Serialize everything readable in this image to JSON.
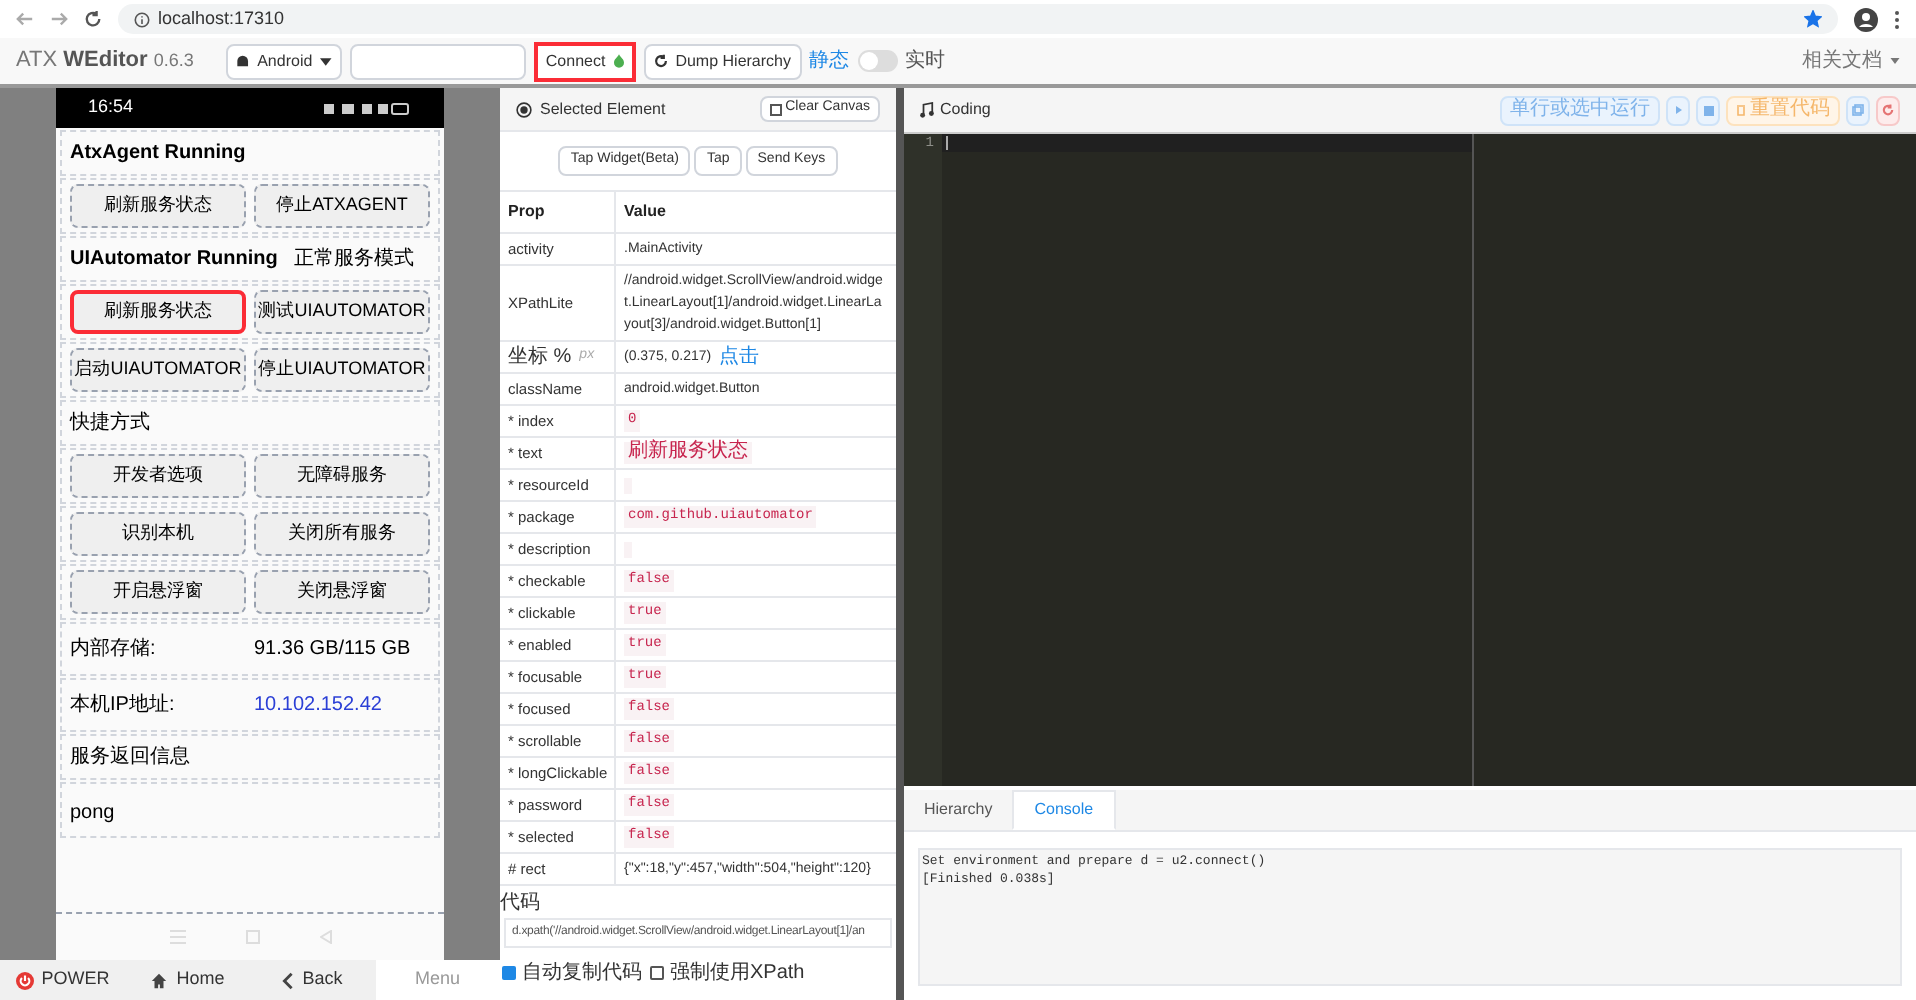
{
  "browser": {
    "url": "localhost:17310",
    "bookmarked": true
  },
  "header": {
    "brand": "ATX",
    "product": "WEditor",
    "version": "0.6.3",
    "platform": "Android",
    "connect": "Connect",
    "dump": "Dump Hierarchy",
    "static_label": "静态",
    "live": false,
    "live_label": "实时",
    "docs": "相关文档"
  },
  "phone": {
    "time": "16:54",
    "rows": [
      {
        "kind": "heading",
        "texts": [
          "AtxAgent Running"
        ],
        "bold": true
      },
      {
        "kind": "buttons",
        "buttons": [
          {
            "label": "刷新服务状态",
            "selected": false
          },
          {
            "label": "停止ATXAGENT",
            "selected": false
          }
        ]
      },
      {
        "kind": "heading",
        "texts": [
          "UIAutomator Running",
          "正常服务模式"
        ],
        "bold": true
      },
      {
        "kind": "buttons",
        "buttons": [
          {
            "label": "刷新服务状态",
            "selected": true
          },
          {
            "label": "测试UIAUTOMATOR",
            "selected": false
          }
        ]
      },
      {
        "kind": "buttons",
        "buttons": [
          {
            "label": "启动UIAUTOMATOR",
            "selected": false
          },
          {
            "label": "停止UIAUTOMATOR",
            "selected": false
          }
        ]
      },
      {
        "kind": "heading",
        "texts": [
          "快捷方式"
        ],
        "bold": false
      },
      {
        "kind": "buttons",
        "buttons": [
          {
            "label": "开发者选项",
            "selected": false
          },
          {
            "label": "无障碍服务",
            "selected": false
          }
        ]
      },
      {
        "kind": "buttons",
        "buttons": [
          {
            "label": "识别本机",
            "selected": false
          },
          {
            "label": "关闭所有服务",
            "selected": false
          }
        ]
      },
      {
        "kind": "buttons",
        "buttons": [
          {
            "label": "开启悬浮窗",
            "selected": false
          },
          {
            "label": "关闭悬浮窗",
            "selected": false
          }
        ]
      },
      {
        "kind": "info",
        "label": "内部存储:",
        "value": "91.36 GB/115 GB",
        "link": false
      },
      {
        "kind": "info",
        "label": "本机IP地址:",
        "value": "10.102.152.42",
        "link": true
      },
      {
        "kind": "heading",
        "texts": [
          "服务返回信息"
        ],
        "bold": false
      },
      {
        "kind": "text",
        "texts": [
          "pong"
        ]
      }
    ],
    "controls": [
      {
        "label": "POWER",
        "kind": "power"
      },
      {
        "label": "Home",
        "kind": "home"
      },
      {
        "label": "Back",
        "kind": "back"
      },
      {
        "label": "Menu",
        "kind": "plain"
      }
    ]
  },
  "inspector": {
    "title": "Selected Element",
    "clear": "Clear Canvas",
    "actions": [
      "Tap Widget(Beta)",
      "Tap",
      "Send Keys"
    ],
    "columns": [
      "Prop",
      "Value"
    ],
    "rows": [
      {
        "name": "activity",
        "value": ".MainActivity",
        "kind": "text"
      },
      {
        "name": "XPathLite",
        "value": "//android.widget.ScrollView/android.widget.LinearLayout[1]/android.widget.LinearLayout[3]/android.widget.Button[1]",
        "kind": "text"
      },
      {
        "name": "坐标 %",
        "unit": "px",
        "value": "(0.375, 0.217)",
        "link": "点击",
        "kind": "text"
      },
      {
        "name": "className",
        "value": "android.widget.Button",
        "kind": "text"
      },
      {
        "name": "* index",
        "value": "0",
        "kind": "code"
      },
      {
        "name": "* text",
        "value": "刷新服务状态",
        "kind": "code"
      },
      {
        "name": "* resourceId",
        "value": "",
        "kind": "code"
      },
      {
        "name": "* package",
        "value": "com.github.uiautomator",
        "kind": "code"
      },
      {
        "name": "* description",
        "value": "",
        "kind": "code"
      },
      {
        "name": "* checkable",
        "value": "false",
        "kind": "code"
      },
      {
        "name": "* clickable",
        "value": "true",
        "kind": "code"
      },
      {
        "name": "* enabled",
        "value": "true",
        "kind": "code"
      },
      {
        "name": "* focusable",
        "value": "true",
        "kind": "code"
      },
      {
        "name": "* focused",
        "value": "false",
        "kind": "code"
      },
      {
        "name": "* scrollable",
        "value": "false",
        "kind": "code"
      },
      {
        "name": "* longClickable",
        "value": "false",
        "kind": "code"
      },
      {
        "name": "* password",
        "value": "false",
        "kind": "code"
      },
      {
        "name": "* selected",
        "value": "false",
        "kind": "code"
      },
      {
        "name": "# rect",
        "value": "{\"x\":18,\"y\":457,\"width\":504,\"height\":120}",
        "kind": "text"
      }
    ],
    "code_label": "代码",
    "code": "d.xpath('//android.widget.ScrollView/android.widget.LinearLayout[1]/an",
    "options": [
      {
        "label": "自动复制代码",
        "checked": true
      },
      {
        "label": "强制使用XPath",
        "checked": false
      }
    ]
  },
  "editor": {
    "title": "Coding",
    "run_line": "单行或选中运行",
    "reset": "重置代码",
    "line_numbers": [
      "1"
    ],
    "tabs": [
      {
        "label": "Hierarchy",
        "selected": false
      },
      {
        "label": "Console",
        "selected": true
      }
    ],
    "console": [
      "Set environment and prepare d = u2.connect()",
      "[Finished 0.038s]"
    ]
  }
}
